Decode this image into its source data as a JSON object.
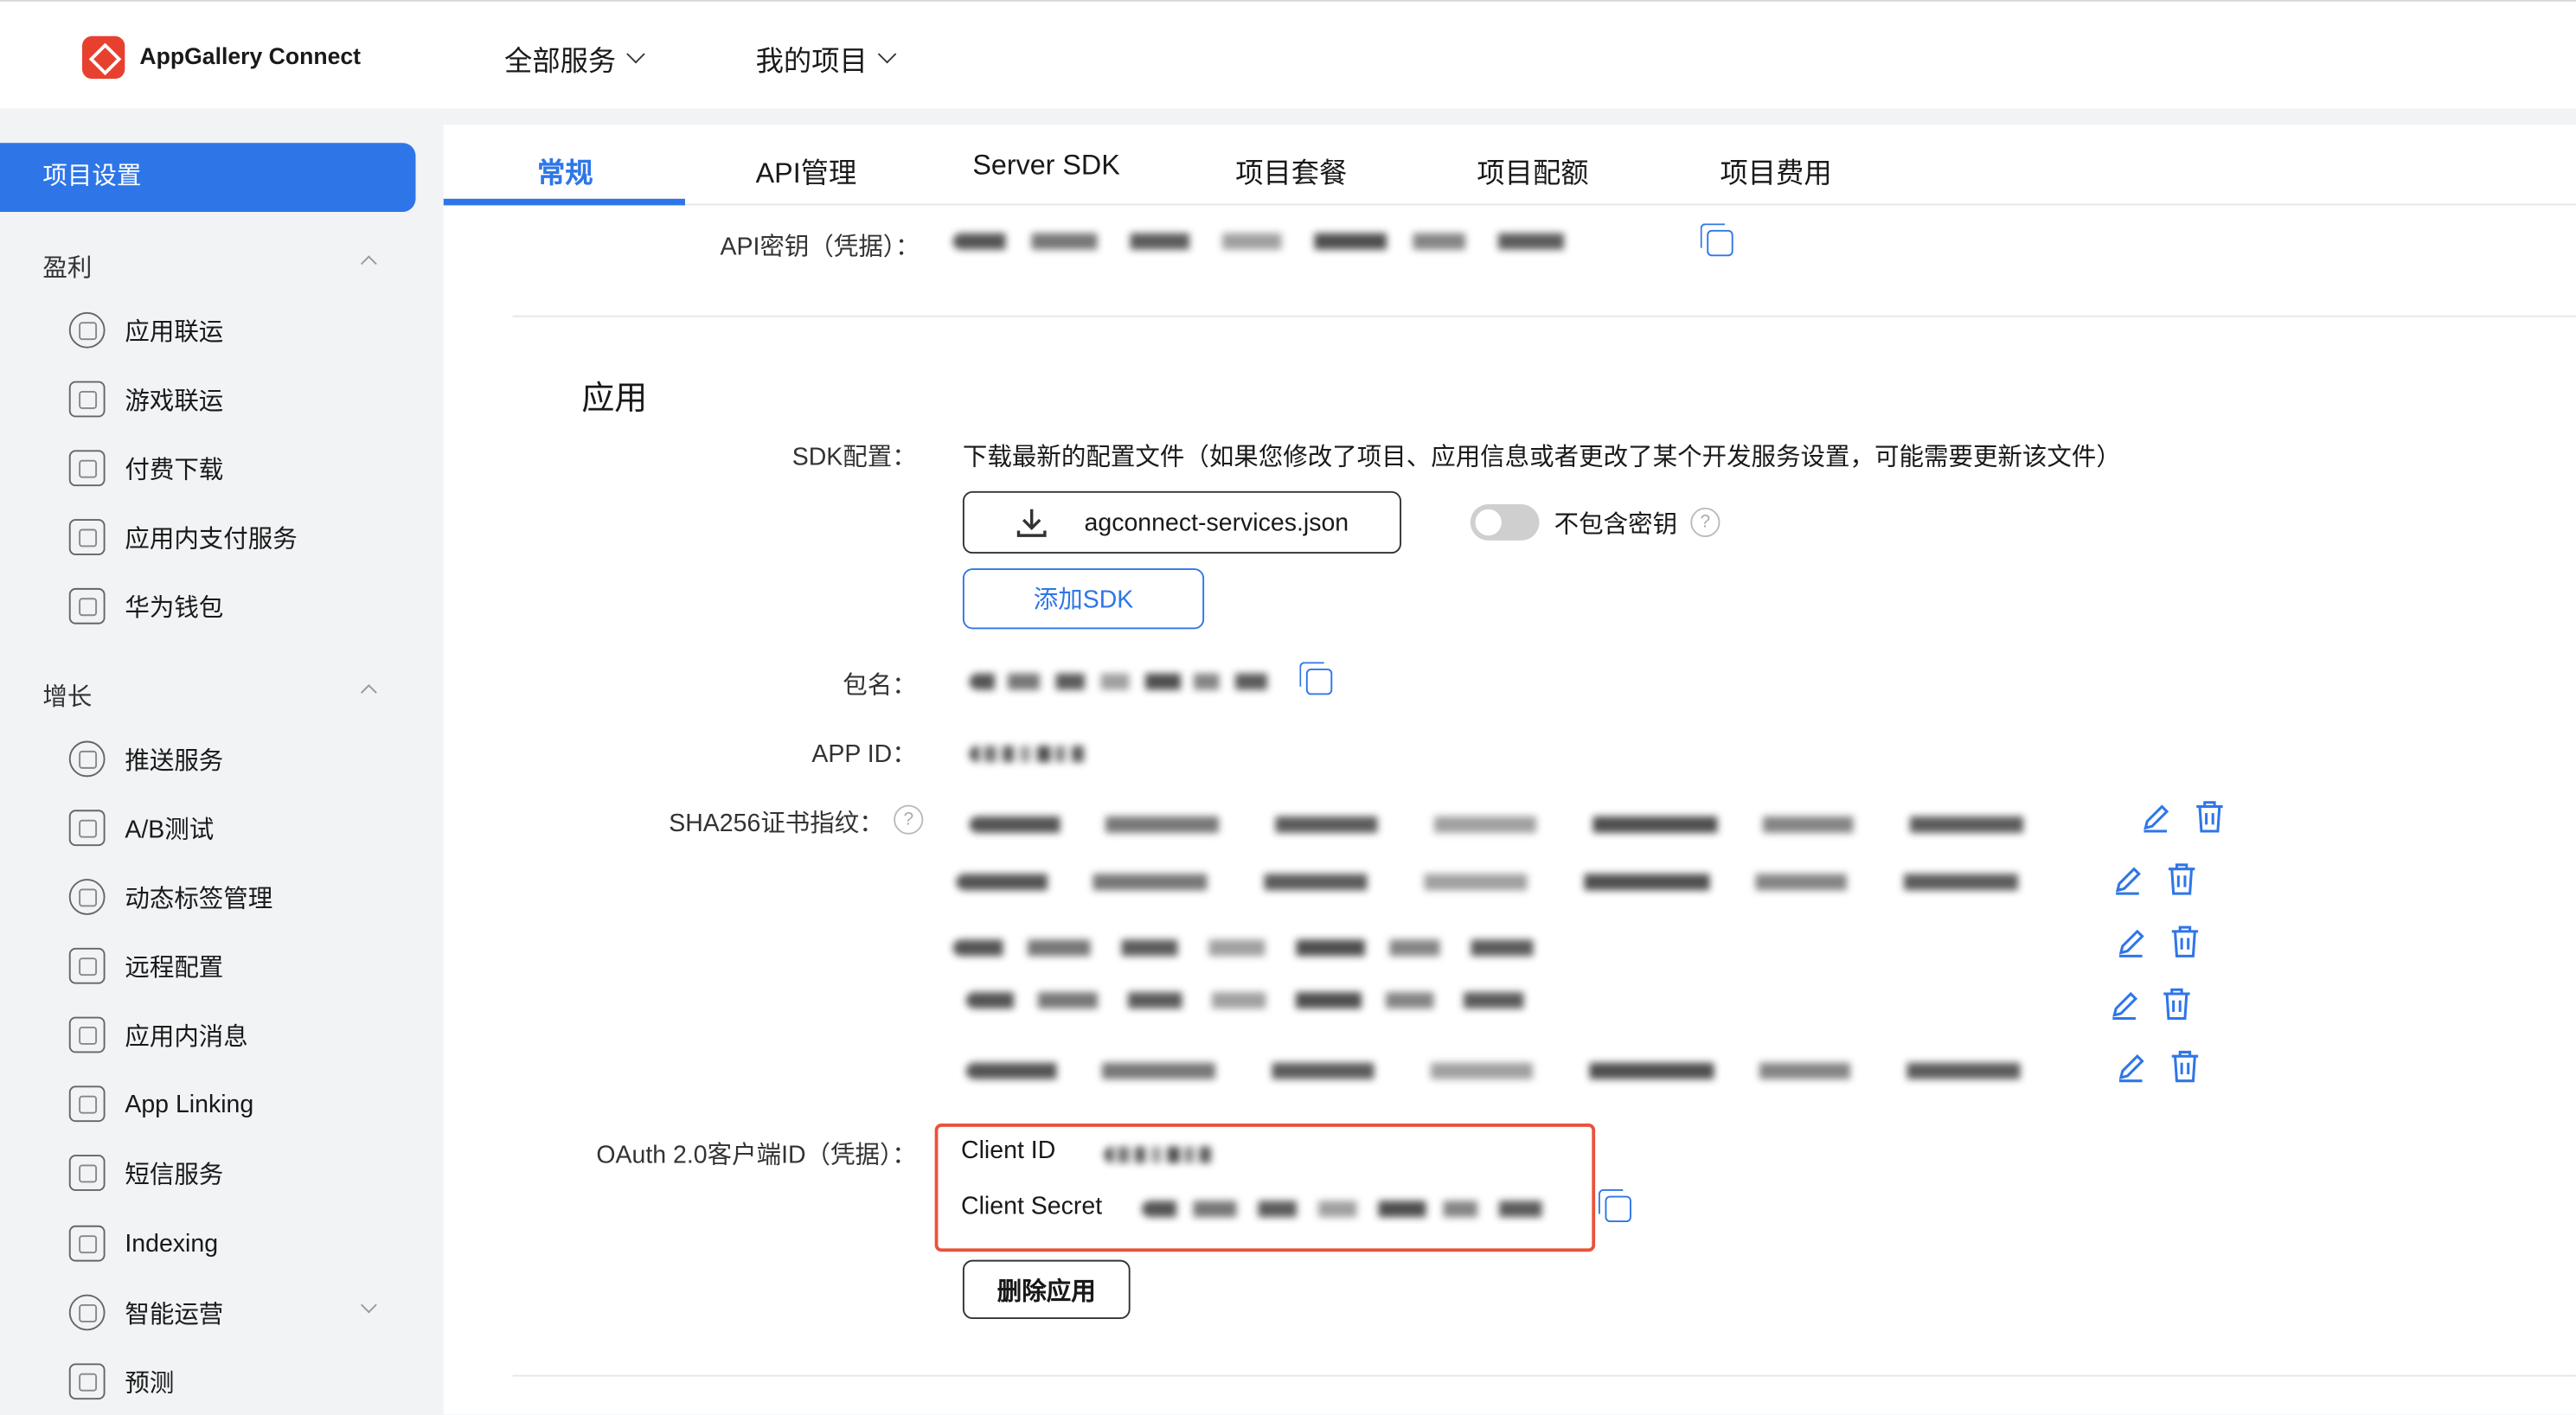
{
  "header": {
    "brand": "AppGallery Connect",
    "nav": [
      "全部服务",
      "我的项目"
    ]
  },
  "sidebar": {
    "active": "项目设置",
    "groups": [
      {
        "title": "盈利",
        "items": [
          "应用联运",
          "游戏联运",
          "付费下载",
          "应用内支付服务",
          "华为钱包"
        ]
      },
      {
        "title": "增长",
        "items": [
          "推送服务",
          "A/B测试",
          "动态标签管理",
          "远程配置",
          "应用内消息",
          "App Linking",
          "短信服务",
          "Indexing",
          "智能运营",
          "预测"
        ]
      }
    ]
  },
  "tabs": [
    "常规",
    "API管理",
    "Server SDK",
    "项目套餐",
    "项目配额",
    "项目费用"
  ],
  "main": {
    "api_key_label": "API密钥（凭据）：",
    "section_title": "应用",
    "sdk_label": "SDK配置：",
    "sdk_desc": "下载最新的配置文件（如果您修改了项目、应用信息或者更改了某个开发服务设置，可能需要更新该文件）",
    "download_file": "agconnect-services.json",
    "toggle_label": "不包含密钥",
    "add_sdk": "添加SDK",
    "package_label": "包名：",
    "appid_label": "APP ID：",
    "sha_label": "SHA256证书指纹：",
    "oauth_label": "OAuth 2.0客户端ID（凭据）：",
    "client_id_label": "Client ID",
    "client_secret_label": "Client Secret",
    "delete_app": "删除应用"
  },
  "colors": {
    "accent": "#2e76e8",
    "highlight_box": "#e8533a",
    "logo": "#e8402f"
  }
}
